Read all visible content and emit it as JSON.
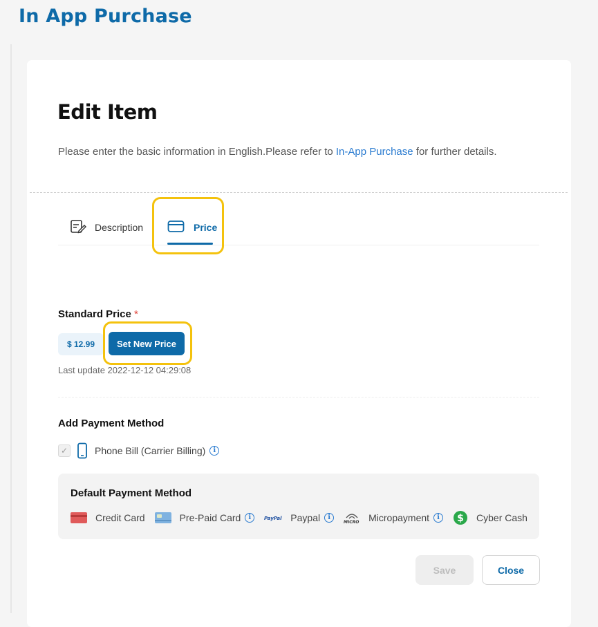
{
  "page": {
    "title": "In App Purchase"
  },
  "card": {
    "title": "Edit Item",
    "intro_prefix": "Please enter the basic information in English.Please refer to ",
    "intro_link": "In-App Purchase",
    "intro_suffix": " for further details."
  },
  "tabs": [
    {
      "label": "Description",
      "icon": "edit-document-icon",
      "active": false
    },
    {
      "label": "Price",
      "icon": "credit-card-icon",
      "active": true
    }
  ],
  "price": {
    "label": "Standard Price",
    "required_mark": "*",
    "current_value": "$ 12.99",
    "set_button": "Set New Price",
    "last_update": "Last update 2022-12-12 04:29:08"
  },
  "add_payment": {
    "label": "Add Payment Method",
    "checkbox_checked": true,
    "method": "Phone Bill (Carrier Billing)"
  },
  "default_payment": {
    "title": "Default Payment Method",
    "items": [
      {
        "label": "Credit Card",
        "icon": "credit-card-icon",
        "info": false
      },
      {
        "label": "Pre-Paid Card",
        "icon": "prepaid-card-icon",
        "info": true
      },
      {
        "label": "Paypal",
        "icon": "paypal-icon",
        "info": true
      },
      {
        "label": "Micropayment",
        "icon": "micropayment-icon",
        "info": true
      },
      {
        "label": "Cyber Cash",
        "icon": "cyber-cash-icon",
        "info": false
      }
    ]
  },
  "actions": {
    "save": "Save",
    "close": "Close"
  },
  "colors": {
    "accent": "#0e6aa8",
    "highlight": "#f4c20d",
    "link": "#2a7bd0"
  }
}
